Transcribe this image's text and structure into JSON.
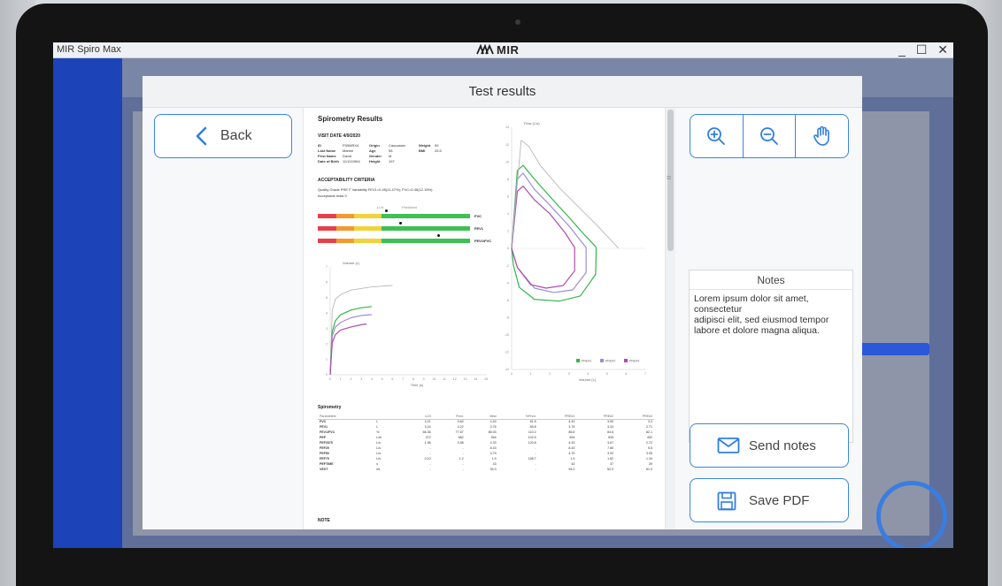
{
  "window": {
    "app_name": "MIR Spiro Max",
    "brand": "MIR",
    "controls": [
      "_",
      "☐",
      "✕"
    ]
  },
  "modal": {
    "title": "Test results",
    "back_label": "Back",
    "tools": [
      "zoom-in",
      "zoom-out",
      "pan"
    ],
    "notes_title": "Notes",
    "notes_text": "Lorem ipsum dolor sit amet,\nconsectetur\nadipisci elit, sed eiusmod tempor\nlabore et dolore magna aliqua.",
    "send_label": "Send notes",
    "save_label": "Save PDF"
  },
  "report": {
    "title": "Spirometry Results",
    "visit": "VISIT DATE 4/9/2020",
    "patient": [
      [
        "ID",
        "P30MRX4",
        "Origin",
        "Caucasian",
        "Weight",
        "99"
      ],
      [
        "Last Name",
        "Martini",
        "Age",
        "55",
        "BMI",
        "25.5"
      ],
      [
        "First Name",
        "David",
        "Gender",
        "M",
        "",
        ""
      ],
      [
        "Date of Birth",
        "11/10/1964",
        "Height",
        "197",
        "",
        ""
      ]
    ],
    "acceptability_title": "ACCEPTABILITY CRITERIA",
    "quality": "Quality Grade PRE F  Variability FEV1=0.45(11.47%); FVC=0.46(12.15%)",
    "acceptable_trials": "Acceptable trials  0",
    "gauge_top_labels": [
      "LLN",
      "Predicted"
    ],
    "gauge_rows": [
      {
        "label": "FVC",
        "marker": 0.45
      },
      {
        "label": "FEV1",
        "marker": 0.54
      },
      {
        "label": "FEV1/FVC",
        "marker": 0.79
      }
    ],
    "spiro_title": "Spirometry",
    "table_headers": [
      "Parameters",
      "",
      "LLN",
      "Pred.",
      "Best",
      "%Pred.",
      "PRE#1",
      "PRE#2",
      "PRE#3"
    ],
    "table_rows": [
      [
        "FVC",
        "L",
        "4.21",
        "5.60",
        "4.43",
        "81.5",
        "4.43",
        "3.90",
        "3.3"
      ],
      [
        "FEV1",
        "L",
        "3.24",
        "4.22",
        "3.76",
        "89.8",
        "3.76",
        "3.34",
        "2.71"
      ],
      [
        "FEV1/FVC",
        "%",
        "66.36",
        "77.67",
        "85.03",
        "110.2",
        "85.6",
        "84.6",
        "82.1"
      ],
      [
        "PEF",
        "L/m",
        "372",
        "582",
        "594",
        "102.5",
        "594",
        "539",
        "452"
      ],
      [
        "FEF2575",
        "L/s",
        "1.96",
        "3.58",
        "4.33",
        "120.8",
        "4.33",
        "3.67",
        "2.72"
      ],
      [
        "FEF25",
        "L/s",
        "-",
        "-",
        "8.43",
        "-",
        "8.43",
        "7.80",
        "5.6"
      ],
      [
        "FEF50",
        "L/s",
        "-",
        "-",
        "4.79",
        "-",
        "4.79",
        "3.92",
        "3.05"
      ],
      [
        "FEF75",
        "L/s",
        "0.10",
        "1.2",
        "1.9",
        "158.7",
        "1.9",
        "1.62",
        "1.34"
      ],
      [
        "PEFTIME",
        "s",
        "-",
        "-",
        "43",
        "-",
        "43",
        "37",
        "39"
      ],
      [
        "VEXT",
        "mL",
        "-",
        "-",
        "94.0",
        "-",
        "94.0",
        "62.0",
        "61.0"
      ]
    ],
    "note_title": "NOTE"
  },
  "chart_data": [
    {
      "type": "line",
      "title": "Flow (L/s)",
      "xlabel": "Volume (L)",
      "ylabel": "Flow (L/s)",
      "xlim": [
        0,
        7
      ],
      "ylim": [
        -14,
        14
      ],
      "x_ticks": [
        "0",
        "1",
        "2",
        "3",
        "4",
        "5",
        "6",
        "7"
      ],
      "y_ticks": [
        "14",
        "12",
        "10",
        "8",
        "6",
        "4",
        "2",
        "0",
        "-2",
        "-4",
        "-6",
        "-8",
        "-10",
        "-12",
        "-14"
      ],
      "legend": [
        "PRE#1",
        "PRE#2",
        "PRE#3"
      ],
      "legend_position": "bottom-right",
      "series": [
        {
          "name": "PRE#1",
          "color": "#2fb84a",
          "x": [
            0,
            0.3,
            0.6,
            1.2,
            2,
            3,
            3.8,
            4.4,
            4.43,
            4.4,
            3.6,
            2.5,
            1.2,
            0.4,
            0.1,
            0
          ],
          "y": [
            0,
            9,
            9.6,
            8,
            6,
            3.6,
            1.6,
            0.2,
            0,
            -3,
            -5.5,
            -6.1,
            -5.9,
            -4.5,
            -2,
            0
          ]
        },
        {
          "name": "PRE#2",
          "color": "#9b8fd8",
          "x": [
            0,
            0.3,
            0.6,
            1.2,
            2,
            3,
            3.5,
            3.9,
            3.9,
            3.2,
            2.2,
            1.2,
            0.3,
            0
          ],
          "y": [
            0,
            8,
            8.7,
            6.8,
            5,
            2.6,
            1.2,
            0.1,
            -2.8,
            -4.8,
            -5.1,
            -4.6,
            -2.2,
            0
          ]
        },
        {
          "name": "PRE#3",
          "color": "#b04aa8",
          "x": [
            0,
            0.3,
            0.6,
            1.2,
            2,
            2.8,
            3.3,
            3.3,
            2.7,
            1.8,
            1,
            0.3,
            0
          ],
          "y": [
            0,
            6.6,
            7.2,
            5.6,
            4,
            1.8,
            0.1,
            -2.6,
            -4.3,
            -4.6,
            -4.2,
            -2.2,
            0
          ]
        },
        {
          "name": "Predicted",
          "color": "#b0b0b0",
          "x": [
            0,
            0.5,
            0.9,
            1.5,
            2.5,
            3.5,
            4.5,
            5.6
          ],
          "y": [
            0,
            12.5,
            11.8,
            9.6,
            7,
            4.8,
            2.6,
            0
          ]
        }
      ]
    },
    {
      "type": "line",
      "title": "Volume (L)",
      "xlabel": "Time (s)",
      "ylabel": "Volume (L)",
      "xlim": [
        0,
        15
      ],
      "ylim": [
        0,
        7
      ],
      "x_ticks": [
        "0",
        "1",
        "2",
        "3",
        "4",
        "5",
        "6",
        "7",
        "8",
        "9",
        "10",
        "11",
        "12",
        "13",
        "14",
        "15"
      ],
      "y_ticks": [
        "0",
        "1",
        "2",
        "3",
        "4",
        "5",
        "6",
        "7"
      ],
      "series": [
        {
          "name": "Predicted",
          "color": "#b0b0b0",
          "x": [
            0,
            0.2,
            0.5,
            1,
            2,
            3,
            4,
            6
          ],
          "y": [
            0,
            4.2,
            4.9,
            5.2,
            5.5,
            5.6,
            5.7,
            5.8
          ]
        },
        {
          "name": "PRE#1",
          "color": "#2fb84a",
          "x": [
            0,
            0.2,
            0.5,
            1,
            2,
            3,
            4
          ],
          "y": [
            0,
            2.8,
            3.5,
            3.9,
            4.2,
            4.35,
            4.43
          ]
        },
        {
          "name": "PRE#2",
          "color": "#9b8fd8",
          "x": [
            0,
            0.2,
            0.5,
            1,
            2,
            3,
            4
          ],
          "y": [
            0,
            2.5,
            3.1,
            3.4,
            3.7,
            3.85,
            3.9
          ]
        },
        {
          "name": "PRE#3",
          "color": "#b04aa8",
          "x": [
            0,
            0.2,
            0.5,
            1,
            2,
            3,
            3.5
          ],
          "y": [
            0,
            2.1,
            2.6,
            2.9,
            3.1,
            3.25,
            3.3
          ]
        }
      ]
    }
  ]
}
